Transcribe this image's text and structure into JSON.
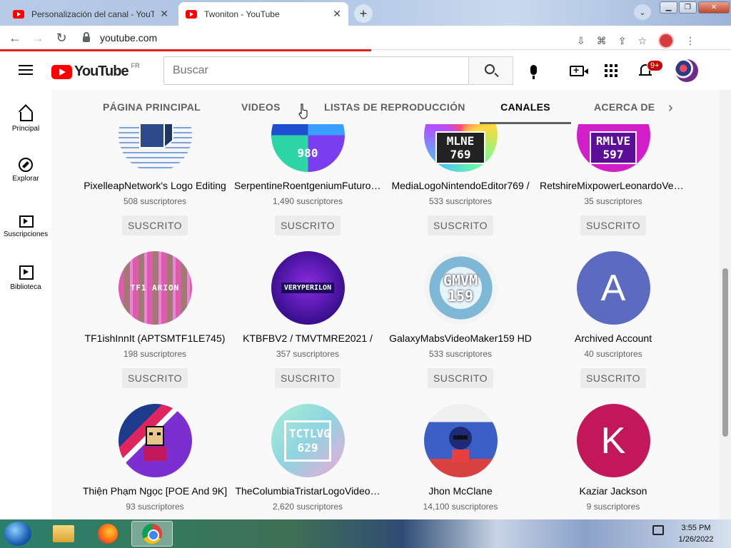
{
  "browser": {
    "tabs": [
      {
        "title": "Personalización del canal - YouTube",
        "active": false
      },
      {
        "title": "Twoniton - YouTube",
        "active": true
      }
    ],
    "new_tab": "+",
    "url": "youtube.com",
    "window_buttons": {
      "minimize": "▁",
      "maximize": "❐",
      "close": "✕"
    }
  },
  "youtube": {
    "logo_text": "YouTube",
    "country_code": "FR",
    "search_placeholder": "Buscar",
    "notification_count": "9+"
  },
  "sidebar": {
    "items": [
      {
        "label": "Principal",
        "icon": "home-icon"
      },
      {
        "label": "Explorar",
        "icon": "compass-icon"
      },
      {
        "label": "Suscripciones",
        "icon": "subscriptions-icon"
      },
      {
        "label": "Biblioteca",
        "icon": "library-icon"
      }
    ]
  },
  "channel_tabs": [
    {
      "label": "PÁGINA PRINCIPAL",
      "selected": false
    },
    {
      "label": "VIDEOS",
      "selected": false
    },
    {
      "label": "LISTAS DE REPRODUCCIÓN",
      "selected": false
    },
    {
      "label": "CANALES",
      "selected": true
    },
    {
      "label": "ACERCA DE",
      "selected": false
    }
  ],
  "channels": [
    {
      "name": "PixelleapNetwork's Logo Editing",
      "subscribers": "508 suscriptores",
      "button": "SUSCRITO",
      "thumb_text": "",
      "thumb_color": "#5b7fc0"
    },
    {
      "name": "SerpentineRoentgeniumFuturol…",
      "subscribers": "1,490 suscriptores",
      "button": "SUSCRITO",
      "thumb_text": "980",
      "thumb_color": "#2a6bd1"
    },
    {
      "name": "MediaLogoNintendoEditor769 /",
      "subscribers": "533 suscriptores",
      "button": "SUSCRITO",
      "thumb_text": "MLNE 769",
      "thumb_color": "#8b5cf6"
    },
    {
      "name": "RetshireMixpowerLeonardoVer…",
      "subscribers": "35 suscriptores",
      "button": "SUSCRITO",
      "thumb_text": "RMLVE 597",
      "thumb_color": "#b026d9"
    },
    {
      "name": "TF1ishInnIt (APTSMTF1LE745)",
      "subscribers": "198 suscriptores",
      "button": "SUSCRITO",
      "thumb_text": "TF1 ARION",
      "thumb_color": "#e48ad1"
    },
    {
      "name": "KTBFBV2 / TMVTMRE2021 /",
      "subscribers": "357 suscriptores",
      "button": "SUSCRITO",
      "thumb_text": "VERYPERILON",
      "thumb_color": "#4b1fb0"
    },
    {
      "name": "GalaxyMabsVideoMaker159 HD",
      "subscribers": "533 suscriptores",
      "button": "SUSCRITO",
      "thumb_text": "GMVM 159",
      "thumb_color": "#7fb8d6"
    },
    {
      "name": "Archived Account",
      "subscribers": "40 suscriptores",
      "button": "SUSCRITO",
      "thumb_text": "A",
      "thumb_color": "#5c6bc0"
    },
    {
      "name": "Thiện Phạm Ngọc [POE And 9K]",
      "subscribers": "93 suscriptores",
      "button": "",
      "thumb_text": "",
      "thumb_color": "#3b5fc4"
    },
    {
      "name": "TheColumbiaTristarLogoVideo…",
      "subscribers": "2,620 suscriptores",
      "button": "",
      "thumb_text": "TCTLVG 629",
      "thumb_color": "#8fd4e0"
    },
    {
      "name": "Jhon McClane",
      "subscribers": "14,100 suscriptores",
      "button": "",
      "thumb_text": "",
      "thumb_color": "#d94040"
    },
    {
      "name": "Kaziar Jackson",
      "subscribers": "9 suscriptores",
      "button": "",
      "thumb_text": "K",
      "thumb_color": "#c2185b"
    }
  ],
  "taskbar": {
    "time": "3:55 PM",
    "date": "1/26/2022"
  }
}
